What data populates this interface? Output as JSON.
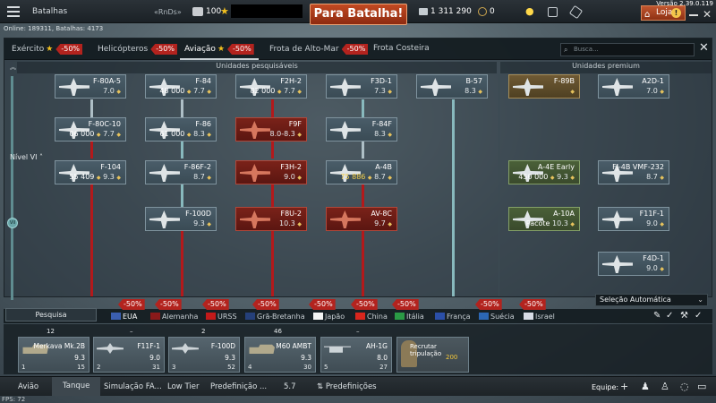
{
  "version": "Versão 2.39.0.119",
  "topbar": {
    "mode": "Batalhas",
    "clan": "«RnDs»",
    "gold": "100",
    "battle_button": "Para Batalha!",
    "lions": "1 311 290",
    "eagles": "0",
    "shop": "Loja",
    "online": "Online: 189311, Batalhas: 4173"
  },
  "tree": {
    "tabs": [
      {
        "label": "Exército",
        "sale": "-50%"
      },
      {
        "label": "Helicópteros",
        "sale": "-50%"
      },
      {
        "label": "Aviação",
        "sale": "-50%"
      },
      {
        "label": "Frota de Alto-Mar",
        "sale": "-50%"
      },
      {
        "label": "Frota Costeira",
        "sale": ""
      }
    ],
    "search_placeholder": "Busca...",
    "researchable_header": "Unidades pesquisáveis",
    "premium_header": "Unidades premium",
    "rank_label": "Nível VI",
    "scroll_label": "VII",
    "units": [
      {
        "name": "F-80A-5",
        "br": "7.0",
        "cost": ""
      },
      {
        "name": "F-84",
        "br": "7.7",
        "cost": "48 000"
      },
      {
        "name": "F2H-2",
        "br": "7.7",
        "cost": "82 000"
      },
      {
        "name": "F3D-1",
        "br": "7.3",
        "cost": ""
      },
      {
        "name": "B-57",
        "br": "8.3",
        "cost": ""
      },
      {
        "name": "F-89B",
        "br": "",
        "cost": ""
      },
      {
        "name": "A2D-1",
        "br": "7.0",
        "cost": ""
      },
      {
        "name": "F-80C-10",
        "br": "7.7",
        "cost": "06 000"
      },
      {
        "name": "F-86",
        "br": "8.3",
        "cost": "61 000"
      },
      {
        "name": "F9F",
        "br": "8.0-8.3",
        "cost": ""
      },
      {
        "name": "F-84F",
        "br": "8.3",
        "cost": ""
      },
      {
        "name": "F-104",
        "br": "9.3",
        "cost": "55 409"
      },
      {
        "name": "F-86F-2",
        "br": "8.7",
        "cost": ""
      },
      {
        "name": "F3H-2",
        "br": "9.0",
        "cost": ""
      },
      {
        "name": "A-4B",
        "br": "8.7",
        "cost": "75 886"
      },
      {
        "name": "A-4E Early",
        "br": "9.3",
        "cost": "450 000"
      },
      {
        "name": "FJ-4B VMF-232",
        "br": "8.7",
        "cost": ""
      },
      {
        "name": "F-100D",
        "br": "9.3",
        "cost": ""
      },
      {
        "name": "F8U-2",
        "br": "10.3",
        "cost": ""
      },
      {
        "name": "AV-8C",
        "br": "9.7",
        "cost": ""
      },
      {
        "name": "A-10A",
        "br": "10.3",
        "cost": "Pacote"
      },
      {
        "name": "F11F-1",
        "br": "9.0",
        "cost": ""
      },
      {
        "name": "F4D-1",
        "br": "9.0",
        "cost": ""
      }
    ]
  },
  "nations_bar": {
    "research_label": "Pesquisa",
    "preset_select": "Seleção Automática",
    "nations": [
      {
        "label": "EUA",
        "sale": "-50%",
        "color": "#3b5fb0"
      },
      {
        "label": "Alemanha",
        "sale": "-50%",
        "color": "#8a1a1a"
      },
      {
        "label": "URSS",
        "sale": "-50%",
        "color": "#c21a1a"
      },
      {
        "label": "Grã-Bretanha",
        "sale": "-50%",
        "color": "#25407a"
      },
      {
        "label": "Japão",
        "sale": "-50%",
        "color": "#f4f4f4"
      },
      {
        "label": "China",
        "sale": "-50%",
        "color": "#d8261d"
      },
      {
        "label": "Itália",
        "sale": "-50%",
        "color": "#2a9a45"
      },
      {
        "label": "França",
        "sale": "",
        "color": "#2b4fa8"
      },
      {
        "label": "Suécia",
        "sale": "-50%",
        "color": "#2c67b5"
      },
      {
        "label": "Israel",
        "sale": "-50%",
        "color": "#2d63c4"
      }
    ]
  },
  "crew_slots": [
    {
      "top": "12",
      "name": "Merkava Mk.2B",
      "br": "9.3",
      "index": "1",
      "extra": "15"
    },
    {
      "top": "–",
      "name": "F11F-1",
      "br": "9.0",
      "index": "2",
      "extra": "31"
    },
    {
      "top": "2",
      "name": "F-100D",
      "br": "9.3",
      "index": "3",
      "extra": "52"
    },
    {
      "top": "46",
      "name": "M60 AMBT",
      "br": "9.3",
      "index": "4",
      "extra": "30"
    },
    {
      "top": "–",
      "name": "AH-1G",
      "br": "8.0",
      "index": "5",
      "extra": "27"
    }
  ],
  "recruit": {
    "label": "Recrutar tripulação",
    "cost": "200"
  },
  "bottom": {
    "items": [
      "Avião",
      "Tanque",
      "Simulação FA...",
      "Low Tier",
      "Predefinição ...",
      "5.7",
      "Predefinições"
    ],
    "equipe": "Equipe:",
    "fps": "FPS: 72"
  }
}
